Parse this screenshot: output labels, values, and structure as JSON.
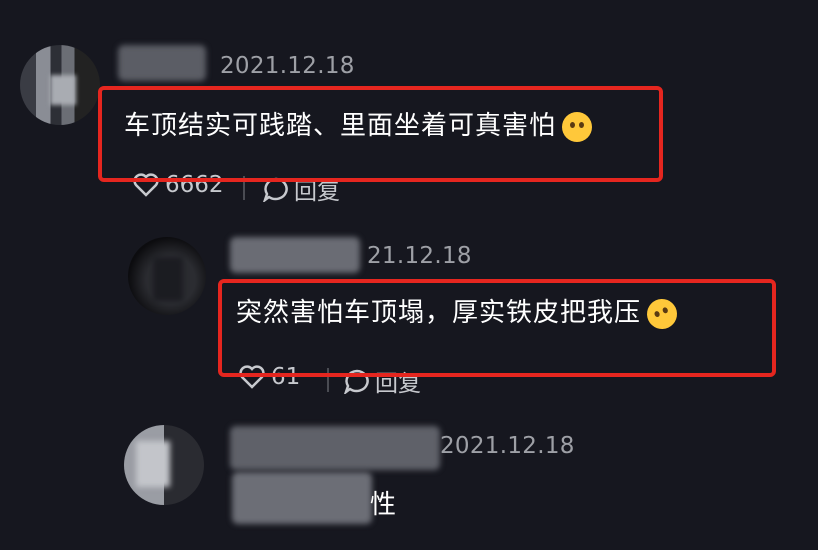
{
  "comments": [
    {
      "date": "2021.12.18",
      "text": "车顶结实可践踏、里面坐着可真害怕",
      "emoji": "pleading-face-emoji",
      "likes": "6662",
      "reply_label": "回复"
    },
    {
      "date": "21.12.18",
      "text": "突然害怕车顶塌，厚实铁皮把我压",
      "emoji": "rolling-laughing-emoji",
      "likes": "61",
      "reply_label": "回复"
    },
    {
      "date": "2021.12.18",
      "text_visible_tail": "性"
    }
  ],
  "colors": {
    "background": "#16171f",
    "highlight": "#e5261f",
    "text": "#ffffff",
    "meta": "#9ea0a6"
  }
}
